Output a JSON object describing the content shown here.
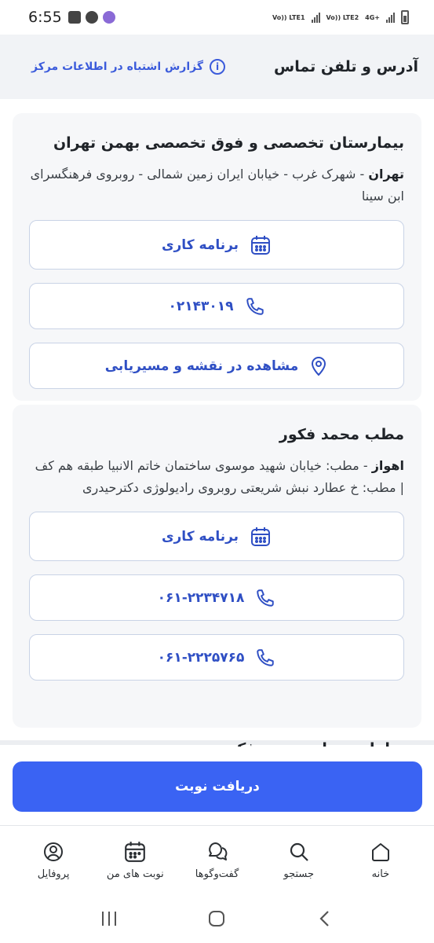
{
  "status_bar": {
    "time": "6:55",
    "sim1": "Vo)) LTE1",
    "sim2": "Vo)) LTE2",
    "net": "4G+"
  },
  "header": {
    "title": "آدرس و تلفن تماس",
    "report_label": "گزارش اشتباه در اطلاعات مرکز"
  },
  "cards": [
    {
      "title": "بیمارستان تخصصی و فوق تخصصی بهمن تهران",
      "city": "تهران",
      "address": " - شهرک غرب - خیابان ایران زمین شمالی - روبروی فرهنگسرای ابن سینا",
      "buttons": [
        {
          "label": "برنامه کاری",
          "icon": "calendar-icon"
        },
        {
          "label": "۰۲۱۴۳۰۱۹",
          "icon": "phone-icon"
        },
        {
          "label": "مشاهده در نقشه و مسیریابی",
          "icon": "map-pin-icon"
        }
      ]
    },
    {
      "title": "مطب محمد فکور",
      "city": "اهواز",
      "address": " - مطب: خیابان شهید موسوی ساختمان خاتم الانبیا طبقه هم کف | مطب: خ عطارد نبش شریعتی روبروی رادیولوژی دکترحیدری",
      "buttons": [
        {
          "label": "برنامه کاری",
          "icon": "calendar-icon"
        },
        {
          "label": "۰۶۱-۲۲۳۴۷۱۸",
          "icon": "phone-icon"
        },
        {
          "label": "۰۶۱-۲۲۲۵۷۶۵",
          "icon": "phone-icon"
        }
      ]
    }
  ],
  "peek_text": "نظرات درباره محمد فکور",
  "cta": {
    "label": "دریافت نوبت"
  },
  "bottom_nav": [
    {
      "label": "خانه",
      "icon": "home-icon"
    },
    {
      "label": "جستجو",
      "icon": "search-icon"
    },
    {
      "label": "گفت‌وگوها",
      "icon": "chat-icon"
    },
    {
      "label": "نوبت های من",
      "icon": "calendar-icon"
    },
    {
      "label": "پروفایل",
      "icon": "profile-icon"
    }
  ],
  "colors": {
    "accent": "#3a63f3",
    "link": "#2f4fc4",
    "card_bg": "#f6f7f9",
    "header_bg": "#f1f3f6"
  }
}
